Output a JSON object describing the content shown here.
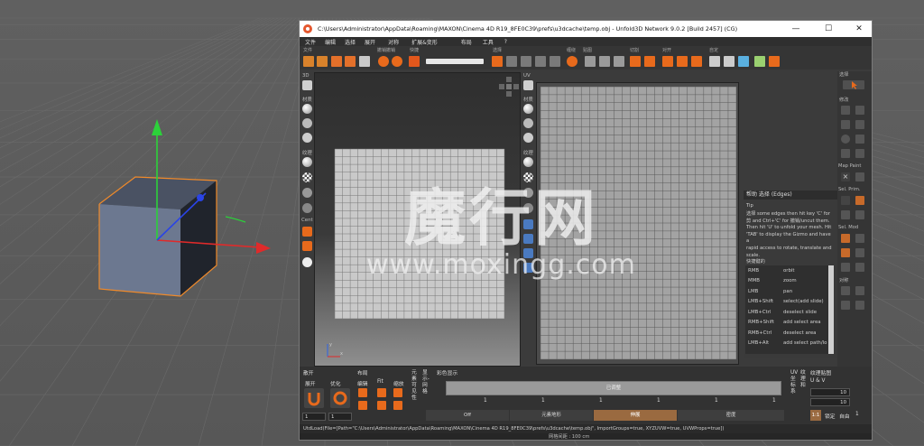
{
  "colors": {
    "accent": "#e86a1c",
    "uv_grid": "#9a9a9a",
    "titlebar": "#ffffff"
  },
  "window": {
    "title": "C:\\Users\\Administrator\\AppData\\Roaming\\MAXON\\Cinema 4D R19_8FE0C39\\prefs\\u3dcache\\temp.obj - Unfold3D Network 9.0.2 [Build 2457] (CG)",
    "min_glyph": "—",
    "max_glyph": "☐",
    "close_glyph": "✕"
  },
  "menu": [
    "文件",
    "编辑",
    "选择",
    "展开",
    "对称",
    "扩展&变形",
    "布局",
    "工具",
    "?"
  ],
  "toolbar_labels": [
    "文件",
    "撤销撤销",
    "快捷",
    "选择",
    "缠绕",
    "贴图",
    "切割",
    "对开",
    "自定"
  ],
  "side3d": {
    "top": "3D",
    "material": "材质",
    "texture": "纹理",
    "center": "Cent"
  },
  "sideuv": {
    "top": "UV",
    "material": "材质",
    "texture": "纹理"
  },
  "help": {
    "header": "帮助 选择 (Edges)",
    "tip_label": "Tip",
    "tip_lines": [
      "选择  some edges then hit key 'C' for",
      "剪  and Ctrl+'C' for 撤销/uncut them.",
      "Then hit 'U' to unfold your mesh. Hit",
      "'TAB' to display the Gizmo and have a",
      "rapid access to rotate, translate and",
      "scale."
    ],
    "keys_label": "快捷键的",
    "keys": [
      {
        "key": "RMB",
        "action": "orbit"
      },
      {
        "key": "MMB",
        "action": "zoom"
      },
      {
        "key": "LMB",
        "action": "pan"
      },
      {
        "key": "LMB+Shift",
        "action": "select(add slide)"
      },
      {
        "key": "LMB+Ctrl",
        "action": "deselect slide"
      },
      {
        "key": "RMB+Shift",
        "action": "add select area"
      },
      {
        "key": "RMB+Ctrl",
        "action": "deselect area"
      },
      {
        "key": "LMB+Alt",
        "action": "add select path/lo"
      }
    ]
  },
  "rightcol": {
    "select": "选择",
    "modify": "修改",
    "map_paint": "Map Paint",
    "sel_prim": "Sel. Prim.",
    "sel_mod": "Sel. Mod",
    "symmetry": "对称"
  },
  "bottom": {
    "unfold_section": "散开",
    "unfold": "展开",
    "optimize": "优化",
    "layout_section": "布局",
    "layout_edit": "编辑",
    "layout_fit": "Fit",
    "layout_scale": "缩放",
    "unfold_val1": "1",
    "unfold_val2": "1",
    "vtab1": "元素可见性",
    "vtab2": "显示-网格",
    "color_section": "彩色显示",
    "progress_label": "已调整",
    "ticks": [
      "1",
      "1",
      "1",
      "1",
      "1",
      "1"
    ],
    "seg": [
      "Off",
      "元素地形",
      "伸展",
      "密度"
    ],
    "uv_vtab": "UV坐标系",
    "uv_vtab2": "纹理和",
    "tex_section": "纹理贴图",
    "uv_label": "U & V",
    "val1": "10",
    "val2": "10",
    "ratio": "1:1",
    "b1": "锁定",
    "b2": "自由",
    "b3": "1"
  },
  "status": {
    "command": "UtdLoad(File=[Path=\"C:\\Users\\Administrator\\AppData\\Roaming\\MAXON\\Cinema 4D R19_8FE0C39\\prefs\\u3dcache\\temp.obj\", ImportGroups=true, XYZUVW=true, UVWProps=true])",
    "grid_size": "网格间距 : 100 cm"
  },
  "watermark": {
    "cn": "魔行网",
    "url": "www.moxingg.com"
  }
}
